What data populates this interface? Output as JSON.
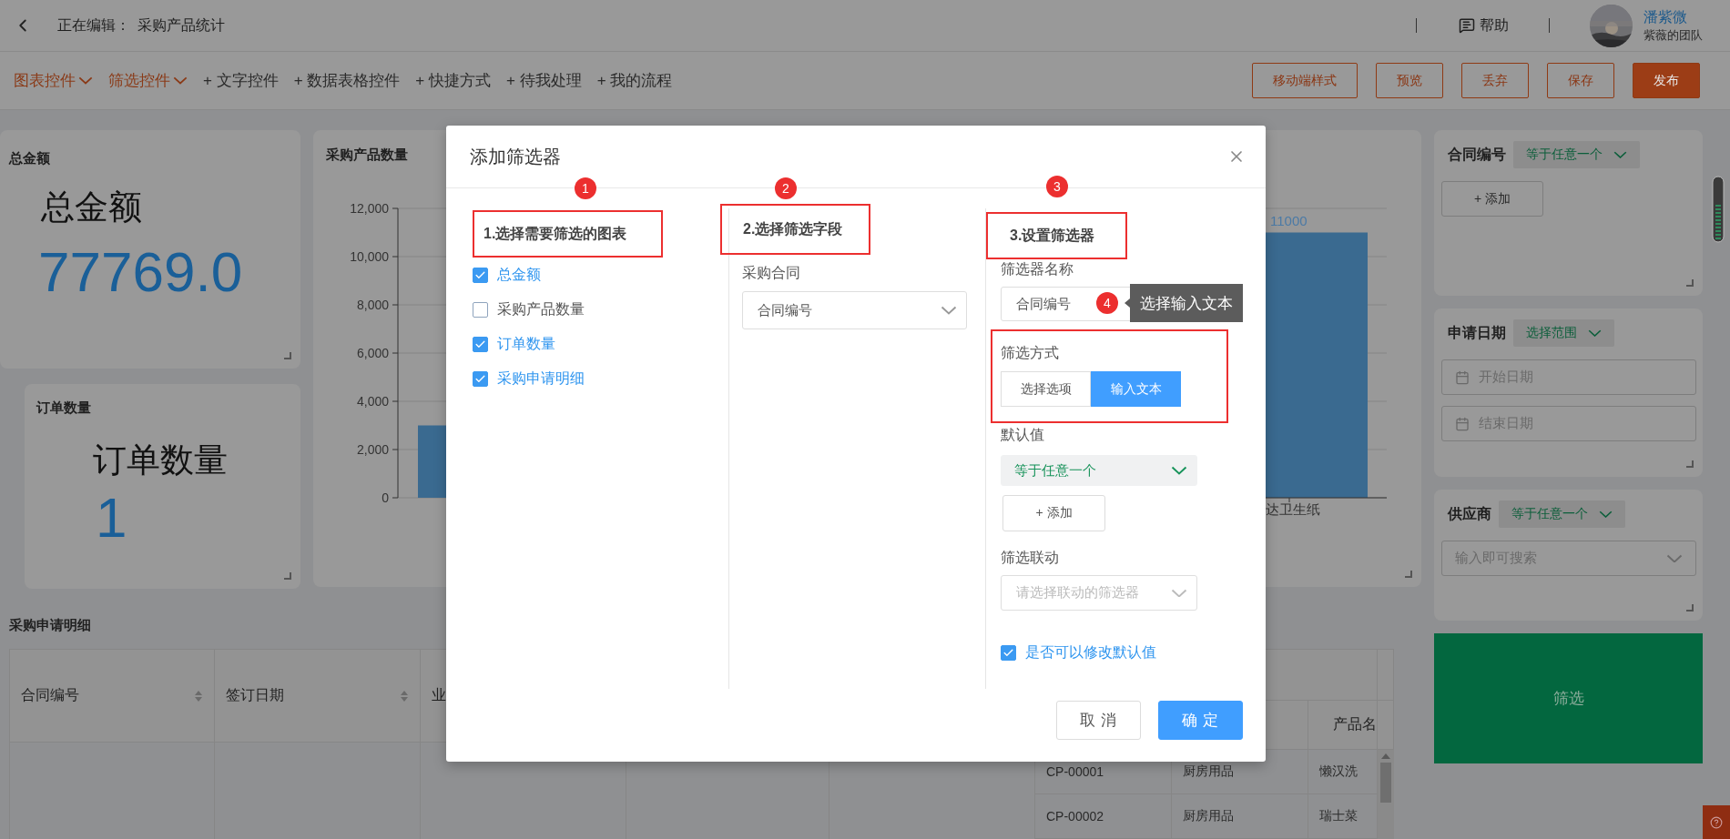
{
  "header": {
    "prefix": "正在编辑：",
    "title": "采购产品统计",
    "help": "帮助",
    "user": {
      "name": "潘紫微",
      "team": "紫薇的团队"
    }
  },
  "toolbar": {
    "menus": [
      {
        "label": "图表控件",
        "kind": "dropdown"
      },
      {
        "label": "筛选控件",
        "kind": "dropdown"
      },
      {
        "label": "+ 文字控件",
        "kind": "link"
      },
      {
        "label": "+ 数据表格控件",
        "kind": "link"
      },
      {
        "label": "+ 快捷方式",
        "kind": "link"
      },
      {
        "label": "+ 待我处理",
        "kind": "link"
      },
      {
        "label": "+ 我的流程",
        "kind": "link"
      }
    ],
    "buttons": [
      {
        "label": "移动端样式",
        "primary": false
      },
      {
        "label": "预览",
        "primary": false
      },
      {
        "label": "丢弃",
        "primary": false
      },
      {
        "label": "保存",
        "primary": false
      },
      {
        "label": "发布",
        "primary": true
      }
    ]
  },
  "total_card": {
    "title": "总金额",
    "label": "总金额",
    "value": "77769.0"
  },
  "orders_card": {
    "title": "订单数量",
    "label": "订单数量",
    "value": "1"
  },
  "chart": {
    "title": "采购产品数量",
    "chart_data": {
      "type": "bar",
      "grid": true,
      "categories": [
        null,
        "达卫生纸"
      ],
      "values": [
        3000,
        11000
      ],
      "value_labels": [
        null,
        "11000"
      ],
      "ylim": [
        0,
        12000
      ],
      "yticks": [
        {
          "value": 0,
          "label": "0"
        },
        {
          "value": 2000,
          "label": "2,000"
        },
        {
          "value": 4000,
          "label": "4,000"
        },
        {
          "value": 6000,
          "label": "6,000"
        },
        {
          "value": 8000,
          "label": "8,000"
        },
        {
          "value": 10000,
          "label": "10,000"
        },
        {
          "value": 12000,
          "label": "12,000"
        }
      ]
    }
  },
  "table": {
    "title": "采购申请明细",
    "columns": [
      {
        "label": "合同编号",
        "sortable": true
      },
      {
        "label": "签订日期",
        "sortable": true
      },
      {
        "label": "业"
      }
    ],
    "side_column": "产品名",
    "rows": [
      {
        "cells": [
          "CP-00001",
          "厨房用品",
          "懒汉洗"
        ]
      },
      {
        "cells": [
          "CP-00002",
          "厨房用品",
          "瑞士菜"
        ]
      }
    ]
  },
  "filters": [
    {
      "label": "合同编号",
      "mode": "等于任意一个",
      "kind": "add",
      "add_label": "+ 添加"
    },
    {
      "label": "申请日期",
      "mode": "选择范围",
      "kind": "date_range",
      "placeholders": [
        "开始日期",
        "结束日期"
      ]
    },
    {
      "label": "供应商",
      "mode": "等于任意一个",
      "kind": "search",
      "placeholder": "输入即可搜索"
    }
  ],
  "filter_button": "筛选",
  "dialog": {
    "title": "添加筛选器",
    "charts_column": {
      "badge": "1",
      "heading": "1.选择需要筛选的图表",
      "items": [
        {
          "label": "总金额",
          "checked": true
        },
        {
          "label": "采购产品数量",
          "checked": false
        },
        {
          "label": "订单数量",
          "checked": true
        },
        {
          "label": "采购申请明细",
          "checked": true
        }
      ]
    },
    "field_column": {
      "badge": "2",
      "heading": "2.选择筛选字段",
      "group_label": "采购合同",
      "field": "合同编号"
    },
    "settings_column": {
      "badge": "3",
      "heading": "3.设置筛选器",
      "name_label": "筛选器名称",
      "name_value": "合同编号",
      "hint_badge": "4",
      "hint": "选择输入文本",
      "method_label": "筛选方式",
      "methods": [
        {
          "label": "选择选项",
          "selected": false
        },
        {
          "label": "输入文本",
          "selected": true
        }
      ],
      "default_label": "默认值",
      "default_mode": "等于任意一个",
      "add_label": "+ 添加",
      "link_label": "筛选联动",
      "link_placeholder": "请选择联动的筛选器",
      "editable": {
        "label": "是否可以修改默认值",
        "checked": true
      }
    },
    "buttons": [
      {
        "label": "取 消",
        "primary": false
      },
      {
        "label": "确 定",
        "primary": true
      }
    ]
  }
}
